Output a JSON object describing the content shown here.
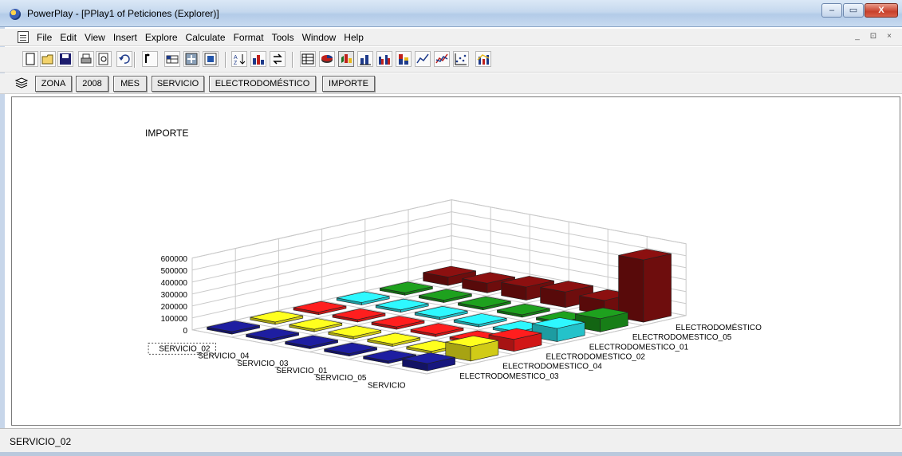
{
  "window": {
    "title": "PowerPlay - [PPlay1 of Peticiones (Explorer)]",
    "minimize_glyph": "–",
    "maximize_glyph": "▭",
    "close_glyph": "X"
  },
  "menu": {
    "items": [
      "File",
      "Edit",
      "View",
      "Insert",
      "Explore",
      "Calculate",
      "Format",
      "Tools",
      "Window",
      "Help"
    ],
    "mdi_controls": [
      "_",
      "⊡",
      "×"
    ]
  },
  "toolbar": {
    "tools": [
      "new-icon",
      "open-icon",
      "save-icon",
      "print-icon",
      "print-preview-icon",
      "undo-icon",
      "drill-up-icon",
      "drill-down-icon",
      "insert-icon",
      "frame-icon",
      "sort-icon",
      "rank-icon",
      "swap-icon",
      "crosstab-icon",
      "pie-icon",
      "3d-bar-icon",
      "simple-bar-icon",
      "clustered-bar-icon",
      "stacked-bar-icon",
      "line-icon",
      "multiline-icon",
      "scatter-icon",
      "correlation-icon"
    ],
    "active_tool": "3d-bar-icon"
  },
  "dimension_bar": {
    "items": [
      "ZONA",
      "2008",
      "MES",
      "SERVICIO",
      "ELECTRODOMÉSTICO",
      "IMPORTE"
    ]
  },
  "chart_data": {
    "type": "bar3d",
    "title": "IMPORTE",
    "yticks": [
      "600000",
      "500000",
      "400000",
      "300000",
      "200000",
      "100000",
      "0"
    ],
    "ylim": [
      0,
      600000
    ],
    "rows": [
      "SERVICIO",
      "SERVICIO_05",
      "SERVICIO_01",
      "SERVICIO_03",
      "SERVICIO_04",
      "SERVICIO_02"
    ],
    "columns": [
      "ELECTRODOMESTICO_03",
      "ELECTRODOMESTICO_04",
      "ELECTRODOMESTICO_02",
      "ELECTRODOMESTICO_01",
      "ELECTRODOMESTICO_05",
      "ELECTRODOMÉSTICO"
    ],
    "selected_row": "SERVICIO_02",
    "column_colors": [
      "#1a1a8c",
      "#e8e21a",
      "#e81a1a",
      "#28d8e0",
      "#1a8c1a",
      "#7a0e0e"
    ],
    "grid": true,
    "values": [
      [
        60000,
        120000,
        100000,
        110000,
        110000,
        520000
      ],
      [
        0,
        0,
        0,
        0,
        0,
        120000
      ],
      [
        0,
        0,
        0,
        0,
        0,
        130000
      ],
      [
        0,
        0,
        0,
        0,
        0,
        110000
      ],
      [
        0,
        0,
        0,
        0,
        0,
        80000
      ],
      [
        0,
        0,
        0,
        0,
        0,
        70000
      ]
    ]
  },
  "status": {
    "text": "SERVICIO_02"
  }
}
